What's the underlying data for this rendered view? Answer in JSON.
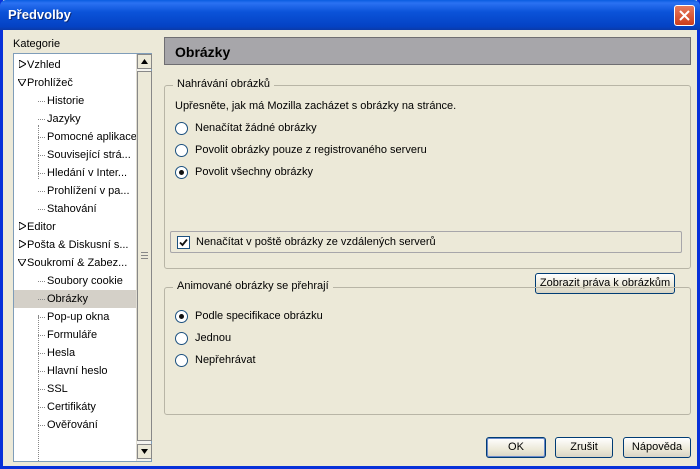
{
  "window": {
    "title": "Předvolby"
  },
  "sidebar": {
    "label": "Kategorie",
    "items": [
      {
        "label": "Vzhled",
        "level": 0,
        "toggle": "collapsed"
      },
      {
        "label": "Prohlížeč",
        "level": 0,
        "toggle": "expanded"
      },
      {
        "label": "Historie",
        "level": 1
      },
      {
        "label": "Jazyky",
        "level": 1
      },
      {
        "label": "Pomocné aplikace",
        "level": 1
      },
      {
        "label": "Související strá...",
        "level": 1
      },
      {
        "label": "Hledání v Inter...",
        "level": 1
      },
      {
        "label": "Prohlížení v pa...",
        "level": 1
      },
      {
        "label": "Stahování",
        "level": 1
      },
      {
        "label": "Editor",
        "level": 0,
        "toggle": "collapsed"
      },
      {
        "label": "Pošta & Diskusní s...",
        "level": 0,
        "toggle": "collapsed"
      },
      {
        "label": "Soukromí & Zabez...",
        "level": 0,
        "toggle": "expanded"
      },
      {
        "label": "Soubory cookie",
        "level": 1
      },
      {
        "label": "Obrázky",
        "level": 1,
        "selected": true
      },
      {
        "label": "Pop-up okna",
        "level": 1
      },
      {
        "label": "Formuláře",
        "level": 1
      },
      {
        "label": "Hesla",
        "level": 1
      },
      {
        "label": "Hlavní heslo",
        "level": 1
      },
      {
        "label": "SSL",
        "level": 1
      },
      {
        "label": "Certifikáty",
        "level": 1
      },
      {
        "label": "Ověřování",
        "level": 1
      }
    ]
  },
  "panel": {
    "title": "Obrázky",
    "loading": {
      "legend": "Nahrávání obrázků",
      "description": "Upřesněte, jak má Mozilla zacházet s obrázky na stránce.",
      "options": [
        {
          "label": "Nenačítat žádné obrázky",
          "checked": false
        },
        {
          "label": "Povolit obrázky pouze z registrovaného serveru",
          "checked": false
        },
        {
          "label": "Povolit všechny obrázky",
          "checked": true
        }
      ],
      "mail_checkbox": {
        "label": "Nenačítat v poště obrázky ze vzdálených serverů",
        "checked": true
      },
      "manage_button": "Zobrazit práva k obrázkům"
    },
    "animation": {
      "legend": "Animované obrázky se přehrají",
      "options": [
        {
          "label": "Podle specifikace obrázku",
          "checked": true
        },
        {
          "label": "Jednou",
          "checked": false
        },
        {
          "label": "Nepřehrávat",
          "checked": false
        }
      ]
    }
  },
  "buttons": {
    "ok": "OK",
    "cancel": "Zrušit",
    "help": "Nápověda"
  }
}
